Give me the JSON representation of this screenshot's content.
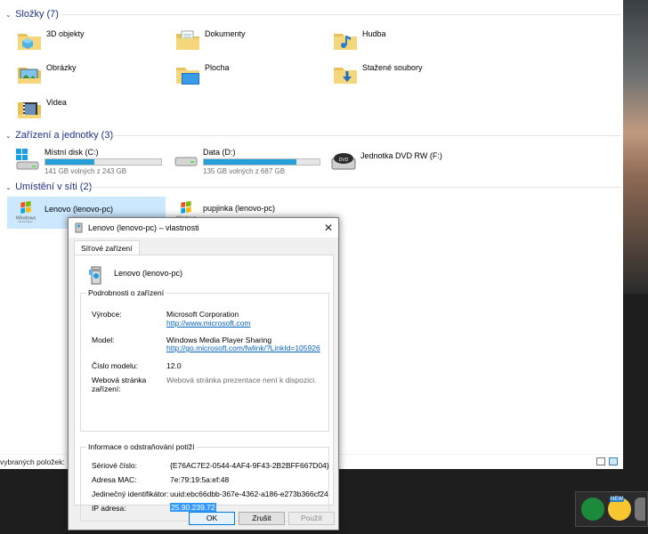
{
  "explorer": {
    "groups": [
      {
        "label": "Složky (7)"
      },
      {
        "label": "Zařízení a jednotky (3)"
      },
      {
        "label": "Umístění v síti (2)"
      }
    ],
    "folders": [
      {
        "label": "3D objekty",
        "icon": "3d-objects-folder-icon"
      },
      {
        "label": "Dokumenty",
        "icon": "documents-folder-icon"
      },
      {
        "label": "Hudba",
        "icon": "music-folder-icon"
      },
      {
        "label": "Obrázky",
        "icon": "pictures-folder-icon"
      },
      {
        "label": "Plocha",
        "icon": "desktop-folder-icon"
      },
      {
        "label": "Stažené soubory",
        "icon": "downloads-folder-icon"
      },
      {
        "label": "Videa",
        "icon": "videos-folder-icon"
      }
    ],
    "drives": [
      {
        "label": "Místní disk (C:)",
        "free": "141 GB volných z 243 GB",
        "used_fraction": 0.42
      },
      {
        "label": "Data (D:)",
        "free": "135 GB volných z 687 GB",
        "used_fraction": 0.8
      },
      {
        "label": "Jednotka DVD RW (F:)"
      }
    ],
    "network": [
      {
        "label": "Lenovo (lenovo-pc)"
      },
      {
        "label": "pupjinka (lenovo-pc)"
      }
    ],
    "status_text": "vybraných položek:"
  },
  "dialog": {
    "title": "Lenovo (lenovo-pc) – vlastnosti",
    "close_glyph": "✕",
    "tab": "Síťové zařízení",
    "device_name": "Lenovo (lenovo-pc)",
    "details_group": "Podrobnosti o zařízení",
    "manufacturer_label": "Výrobce:",
    "manufacturer_value": "Microsoft Corporation",
    "manufacturer_link": "http://www.microsoft.com",
    "model_label": "Model:",
    "model_value": "Windows Media Player Sharing",
    "model_link": "http://go.microsoft.com/fwlink/?LinkId=105926",
    "model_number_label": "Číslo modelu:",
    "model_number_value": "12.0",
    "webpage_label_1": "Webová stránka",
    "webpage_label_2": "zařízení:",
    "webpage_value": "Webová stránka prezentace není k dispozici.",
    "troubleshoot_group": "Informace o odstraňování potíží",
    "serial_label": "Sériové číslo:",
    "serial_value": "{E76AC7E2-0544-4AF4-9F43-2B2BFF667D04}",
    "mac_label": "Adresa MAC:",
    "mac_value": "7e:79:19:5a:ef:48",
    "uid_label": "Jedinečný identifikátor:",
    "uid_value": "uuid:ebc66dbb-367e-4362-a186-e273b366cf24",
    "ip_label": "IP adresa:",
    "ip_value": "25.90.239.72",
    "ok": "OK",
    "cancel": "Zrušit",
    "apply": "Použít"
  },
  "tray": {
    "icons": [
      "green-app-icon",
      "new-emoji-icon",
      "cut-off-icon"
    ],
    "badge": "NEW"
  },
  "colors": {
    "accent": "#26a0da",
    "header_text": "#1e3287",
    "selection": "#cce8ff",
    "ip_highlight": "#3399ff"
  }
}
